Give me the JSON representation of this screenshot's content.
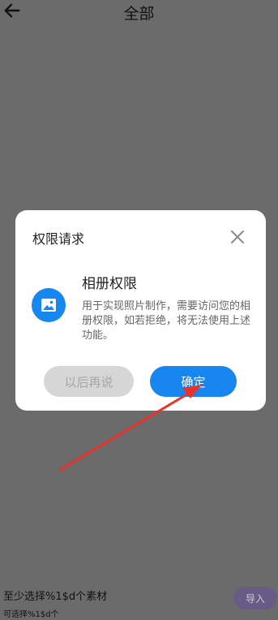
{
  "header": {
    "title": "全部",
    "back_icon": "arrow-left-icon"
  },
  "footer": {
    "hint": "至少选择%1$d个素材",
    "sub_hint": "可选择%1$d个",
    "import_label": "导入"
  },
  "dialog": {
    "title": "权限请求",
    "permission_title": "相册权限",
    "permission_desc": "用于实现照片制作，需要访问您的相册权限，如若拒绝，将无法使用上述功能。",
    "later_label": "以后再说",
    "confirm_label": "确定",
    "icons": {
      "close": "close-icon",
      "permission": "image-icon"
    }
  },
  "colors": {
    "accent": "#1786EF",
    "overlay": "#6B6B6B",
    "annotation": "#E8332B"
  }
}
